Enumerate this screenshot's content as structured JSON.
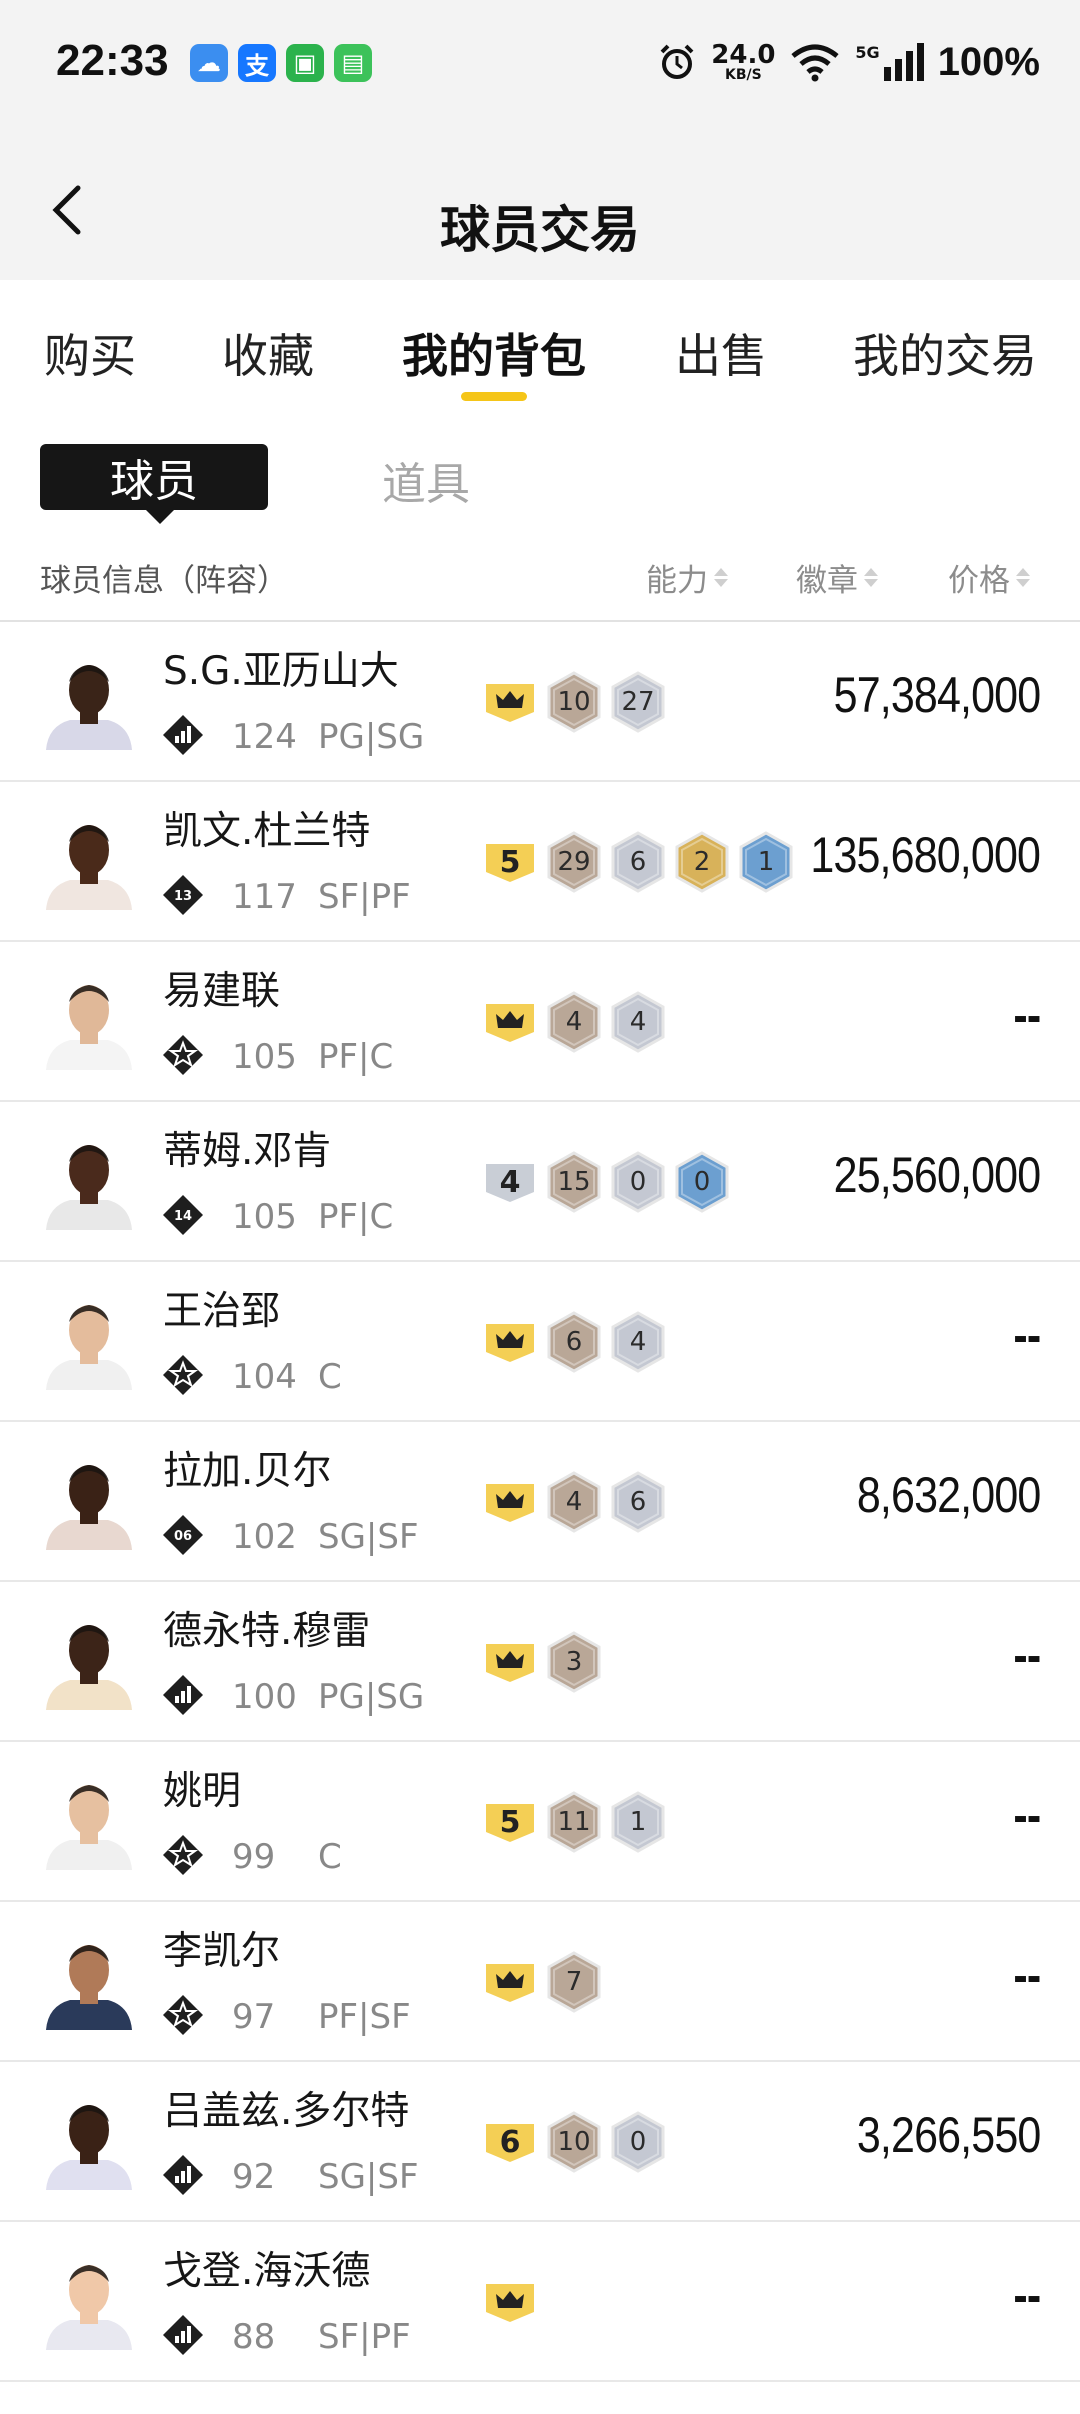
{
  "status_bar": {
    "time": "22:33",
    "net_speed": "24.0",
    "net_unit": "KB/S",
    "network": "5G",
    "battery": "100%"
  },
  "header": {
    "title": "球员交易"
  },
  "tabs": [
    "购买",
    "收藏",
    "我的背包",
    "出售",
    "我的交易"
  ],
  "active_tab": "我的背包",
  "subtabs": {
    "active": "球员",
    "inactive": "道具"
  },
  "columns": {
    "info": "球员信息（阵容）",
    "ability": "能力",
    "badges": "徽章",
    "price": "价格"
  },
  "players": [
    {
      "name": "S.G.亚历山大",
      "rating": "124",
      "position": "PG|SG",
      "level_icon": "bars-level-icon",
      "level_num": "",
      "tier": "crown",
      "badges": [
        [
          "bronze",
          "10"
        ],
        [
          "silver",
          "27"
        ]
      ],
      "price": "57,384,000",
      "jersey": "#d8d8e8",
      "skin": "#3a2418"
    },
    {
      "name": "凯文.杜兰特",
      "rating": "117",
      "position": "SF|PF",
      "level_icon": "number-level-icon",
      "level_num": "13",
      "tier": "5",
      "tier_color": "gold",
      "badges": [
        [
          "bronze",
          "29"
        ],
        [
          "silver",
          "6"
        ],
        [
          "gold",
          "2"
        ],
        [
          "blue",
          "1"
        ]
      ],
      "price": "135,680,000",
      "jersey": "#f0e6e0",
      "skin": "#4a2a1a"
    },
    {
      "name": "易建联",
      "rating": "105",
      "position": "PF|C",
      "level_icon": "star-level-icon",
      "level_num": "",
      "tier": "crown",
      "badges": [
        [
          "bronze",
          "4"
        ],
        [
          "silver",
          "4"
        ]
      ],
      "price": "--",
      "jersey": "#f4f4f4",
      "skin": "#e0b898"
    },
    {
      "name": "蒂姆.邓肯",
      "rating": "105",
      "position": "PF|C",
      "level_icon": "number-level-icon",
      "level_num": "14",
      "tier": "4",
      "tier_color": "silver",
      "badges": [
        [
          "bronze",
          "15"
        ],
        [
          "silver",
          "0"
        ],
        [
          "blue",
          "0"
        ]
      ],
      "price": "25,560,000",
      "jersey": "#e8e8e8",
      "skin": "#4a2a1c"
    },
    {
      "name": "王治郅",
      "rating": "104",
      "position": "C",
      "level_icon": "star-level-icon",
      "level_num": "",
      "tier": "crown",
      "badges": [
        [
          "bronze",
          "6"
        ],
        [
          "silver",
          "4"
        ]
      ],
      "price": "--",
      "jersey": "#f0f0f0",
      "skin": "#e4bc9c"
    },
    {
      "name": "拉加.贝尔",
      "rating": "102",
      "position": "SG|SF",
      "level_icon": "number-level-icon",
      "level_num": "06",
      "tier": "crown",
      "badges": [
        [
          "bronze",
          "4"
        ],
        [
          "silver",
          "6"
        ]
      ],
      "price": "8,632,000",
      "jersey": "#e8d8d0",
      "skin": "#3a2216"
    },
    {
      "name": "德永特.穆雷",
      "rating": "100",
      "position": "PG|SG",
      "level_icon": "bars-level-icon",
      "level_num": "",
      "tier": "crown",
      "badges": [
        [
          "bronze",
          "3"
        ]
      ],
      "price": "--",
      "jersey": "#f2e2c8",
      "skin": "#3c2418"
    },
    {
      "name": "姚明",
      "rating": "99",
      "position": "C",
      "level_icon": "star-level-icon",
      "level_num": "",
      "tier": "5",
      "tier_color": "gold",
      "badges": [
        [
          "bronze",
          "11"
        ],
        [
          "silver",
          "1"
        ]
      ],
      "price": "--",
      "jersey": "#f0f0f0",
      "skin": "#e6c0a0"
    },
    {
      "name": "李凯尔",
      "rating": "97",
      "position": "PF|SF",
      "level_icon": "star-level-icon",
      "level_num": "",
      "tier": "crown",
      "badges": [
        [
          "bronze",
          "7"
        ]
      ],
      "price": "--",
      "jersey": "#2a3a5a",
      "skin": "#b07a58"
    },
    {
      "name": "吕盖兹.多尔特",
      "rating": "92",
      "position": "SG|SF",
      "level_icon": "bars-level-icon",
      "level_num": "",
      "tier": "6",
      "tier_color": "gold",
      "badges": [
        [
          "bronze",
          "10"
        ],
        [
          "silver",
          "0"
        ]
      ],
      "price": "3,266,550",
      "jersey": "#e0e0f0",
      "skin": "#3a2216"
    },
    {
      "name": "戈登.海沃德",
      "rating": "88",
      "position": "SF|PF",
      "level_icon": "bars-level-icon",
      "level_num": "",
      "tier": "crown",
      "badges": [],
      "price": "--",
      "jersey": "#e8e8f0",
      "skin": "#f0c8a8"
    }
  ],
  "colors": {
    "accent": "#f5c518",
    "bronze": "#b9a797",
    "silver": "#c4c8d2",
    "gold": "#d8b25a",
    "blue": "#6c9fd0",
    "tier_gold": "#f4cf55",
    "tier_silver": "#c9ced6"
  }
}
